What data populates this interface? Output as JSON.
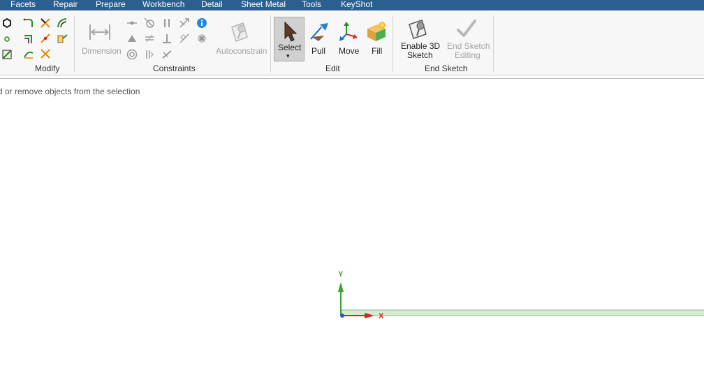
{
  "menu": {
    "tabs": [
      "Facets",
      "Repair",
      "Prepare",
      "Workbench",
      "Detail",
      "Sheet Metal",
      "Tools",
      "KeyShot"
    ]
  },
  "ribbon": {
    "groups": {
      "modify": "Modify",
      "constraints": "Constraints",
      "edit": "Edit",
      "end_sketch": "End Sketch"
    },
    "buttons": {
      "dimension": "Dimension",
      "autoconstrain": "Autoconstrain",
      "select": "Select",
      "pull": "Pull",
      "move": "Move",
      "fill": "Fill",
      "enable3d_line1": "Enable 3D",
      "enable3d_line2": "Sketch",
      "endsketch_line1": "End Sketch",
      "endsketch_line2": "Editing"
    }
  },
  "status_text": "d or remove objects from the selection",
  "axes": {
    "y_label": "Y",
    "x_label": "X"
  },
  "colors": {
    "title_bar": "#2b5f8e",
    "axis_y": "#3aa33a",
    "axis_x": "#e02020",
    "sketch_plane": "#d6ecd2"
  }
}
